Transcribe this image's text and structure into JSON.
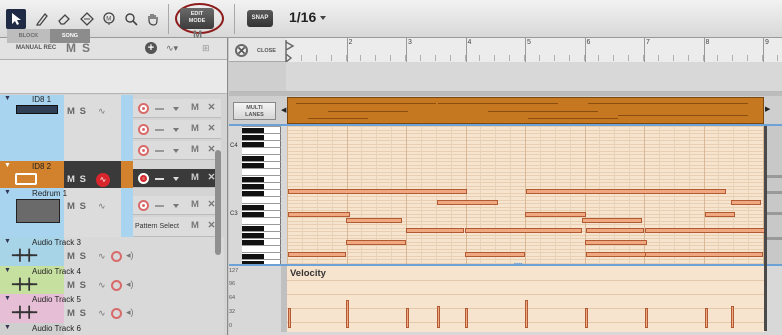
{
  "toolbar": {
    "tools": [
      "arrow-icon",
      "pencil-icon",
      "eraser-icon",
      "razor-icon",
      "mute-tool-icon",
      "magnify-icon",
      "hand-icon"
    ],
    "edit_mode_line1": "EDIT",
    "edit_mode_line2": "MODE",
    "snap_label": "SNAP",
    "quantize_value": "1/16"
  },
  "leftpanel": {
    "manual_rec": "MANUAL REC",
    "mute": "M",
    "solo": "S",
    "block_label": "BLOCK",
    "song_label": "SONG",
    "header_m": "M"
  },
  "tracks": [
    {
      "name": "ID8 1",
      "color": "#a8d4f0"
    },
    {
      "name": "ID8 2",
      "color": "#d2822c"
    },
    {
      "name": "Redrum 1",
      "color": "#a8d4f0"
    },
    {
      "name": "Audio Track 3",
      "color": "#a8d4e8"
    },
    {
      "name": "Audio Track 4",
      "color": "#c6e0a0"
    },
    {
      "name": "Audio Track 5",
      "color": "#e6bfd6"
    },
    {
      "name": "Audio Track 6",
      "color": "#cfcfcf"
    }
  ],
  "lanes": {
    "mute_remove": "M ✕",
    "pattern_select": "Pattern Select"
  },
  "sequencer": {
    "close_label": "CLOSE",
    "ruler_numbers": [
      "2",
      "3",
      "4",
      "5",
      "6",
      "7",
      "8",
      "9"
    ],
    "multi_lanes_line1": "MULTI",
    "multi_lanes_line2": "LANES",
    "octave_labels": [
      "C4",
      "C3"
    ],
    "velocity_title": "Velocity",
    "velocity_scale": [
      "127",
      "96",
      "64",
      "32",
      "0"
    ]
  },
  "colors": {
    "accent": "#6ea2d6",
    "note_fill": "#f0a881",
    "clip": "#c5781f",
    "record_red": "#d8262c"
  }
}
